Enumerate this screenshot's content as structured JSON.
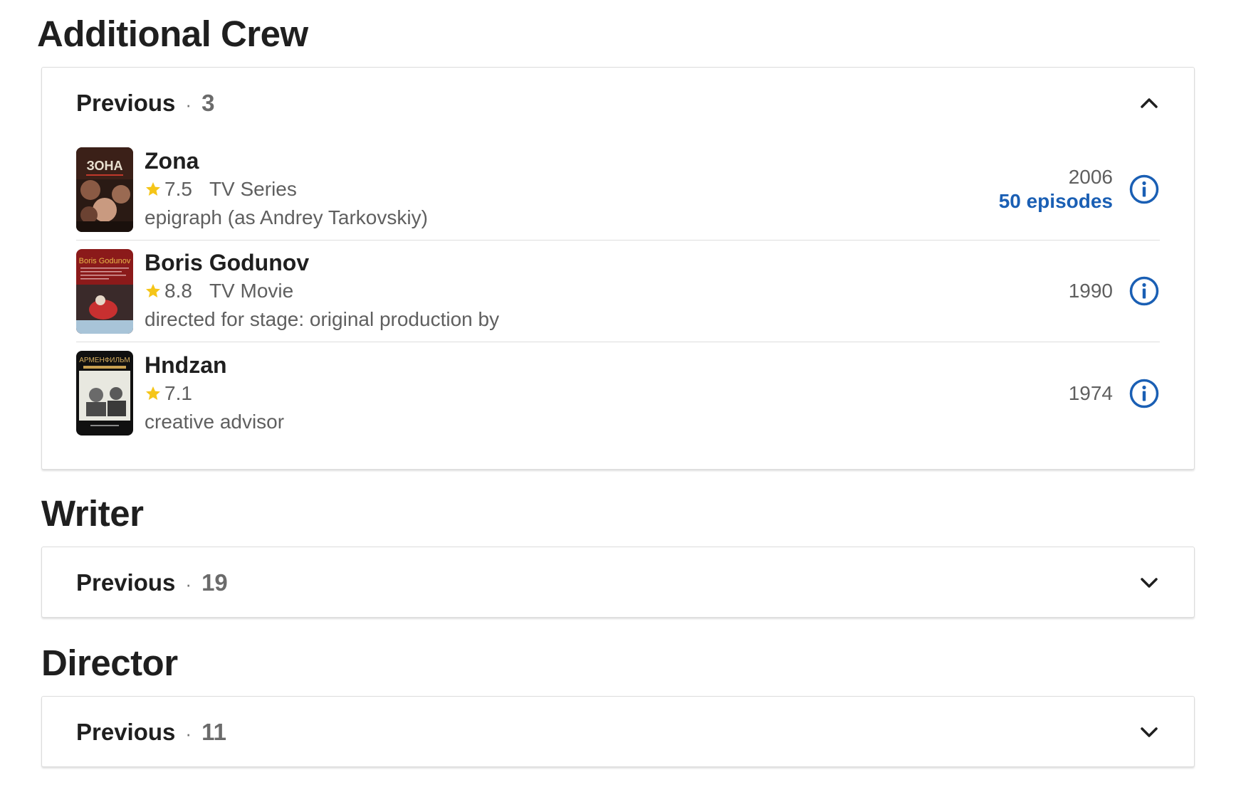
{
  "sections": [
    {
      "title": "Additional Crew",
      "header": {
        "label": "Previous",
        "separator": "·",
        "count": "3",
        "expanded": true
      },
      "credits": [
        {
          "title": "Zona",
          "rating": "7.5",
          "type": "TV Series",
          "role": "epigraph (as Andrey Tarkovskiy)",
          "year": "2006",
          "episodes": "50 episodes",
          "poster_text": "ЗОНА"
        },
        {
          "title": "Boris Godunov",
          "rating": "8.8",
          "type": "TV Movie",
          "role": "directed for stage: original production by",
          "year": "1990",
          "poster_text": "Boris Godunov"
        },
        {
          "title": "Hndzan",
          "rating": "7.1",
          "type": "",
          "role": "creative advisor",
          "year": "1974",
          "poster_text": "АРМЕНФИЛЬМ"
        }
      ]
    },
    {
      "title": "Writer",
      "header": {
        "label": "Previous",
        "separator": "·",
        "count": "19",
        "expanded": false
      }
    },
    {
      "title": "Director",
      "header": {
        "label": "Previous",
        "separator": "·",
        "count": "11",
        "expanded": false
      }
    }
  ],
  "colors": {
    "star": "#f5c518",
    "link_blue": "#1a5fb4",
    "text_secondary": "#5f5f5f"
  },
  "icons": {
    "chevron_up": "chevron-up-icon",
    "chevron_down": "chevron-down-icon",
    "info": "info-circle-icon",
    "star": "star-icon"
  }
}
